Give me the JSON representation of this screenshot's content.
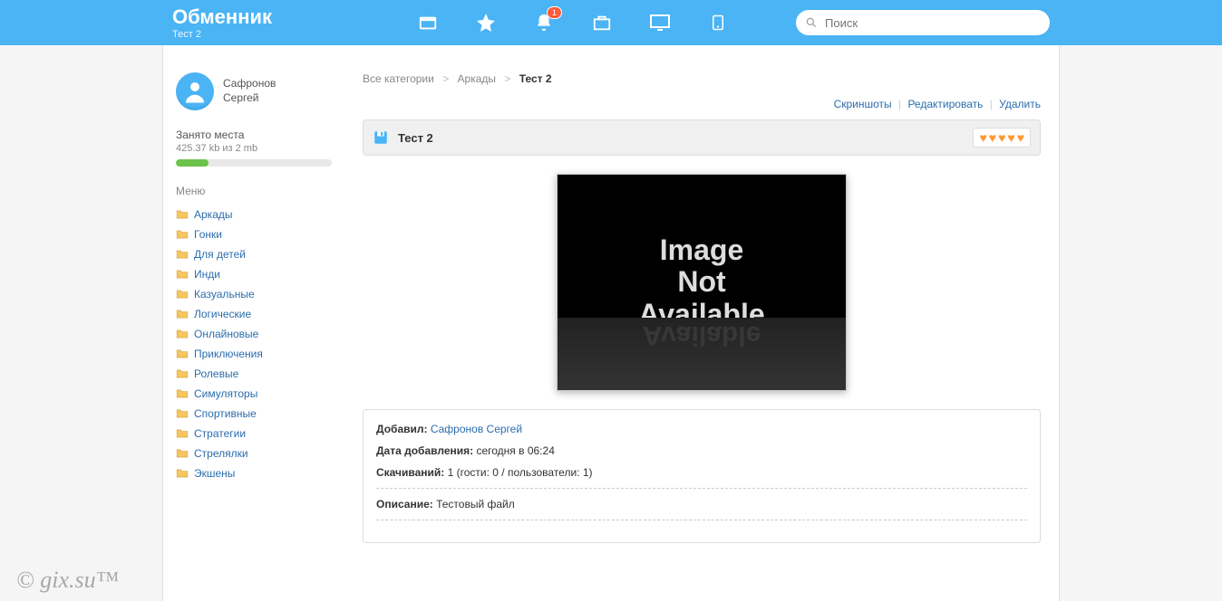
{
  "header": {
    "brand_title": "Обменник",
    "brand_sub": "Тест 2",
    "notification_count": "1",
    "search_placeholder": "Поиск"
  },
  "user": {
    "name_line1": "Сафронов",
    "name_line2": "Сергей"
  },
  "storage": {
    "label": "Занято места",
    "value": "425.37 kb из 2 mb"
  },
  "menu": {
    "title": "Меню",
    "items": [
      "Аркады",
      "Гонки",
      "Для детей",
      "Инди",
      "Казуальные",
      "Логические",
      "Онлайновые",
      "Приключения",
      "Ролевые",
      "Симуляторы",
      "Спортивные",
      "Стратегии",
      "Стрелялки",
      "Экшены"
    ]
  },
  "breadcrumb": {
    "all": "Все категории",
    "cat": "Аркады",
    "current": "Тест 2"
  },
  "actions": {
    "screenshots": "Скриншоты",
    "edit": "Редактировать",
    "delete": "Удалить"
  },
  "title": "Тест 2",
  "image_placeholder": {
    "line1": "Image",
    "line2": "Not",
    "line3": "Available"
  },
  "details": {
    "added_by_label": "Добавил:",
    "added_by_value": "Сафронов Сергей",
    "date_label": "Дата добавления:",
    "date_value": "сегодня в 06:24",
    "downloads_label": "Скачиваний:",
    "downloads_value": "1 (гости: 0 / пользователи: 1)",
    "description_label": "Описание:",
    "description_value": "Тестовый файл"
  },
  "watermark": "© gix.su™"
}
